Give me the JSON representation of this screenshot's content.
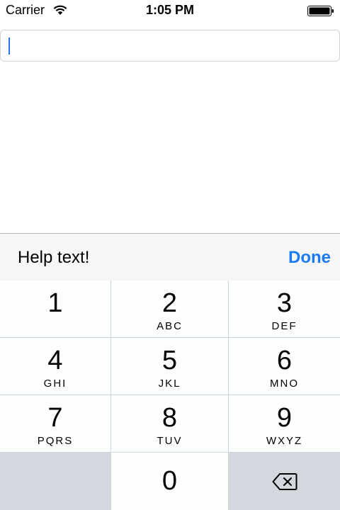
{
  "status_bar": {
    "carrier": "Carrier",
    "time": "1:05 PM",
    "wifi_icon": "wifi-icon",
    "battery_icon": "battery-icon"
  },
  "text_field": {
    "value": "",
    "cursor_color": "#2f6df6"
  },
  "toolbar": {
    "help_text": "Help text!",
    "done_label": "Done",
    "done_color": "#1a7cf5"
  },
  "keypad": {
    "keys": [
      {
        "num": "1",
        "letters": ""
      },
      {
        "num": "2",
        "letters": "ABC"
      },
      {
        "num": "3",
        "letters": "DEF"
      },
      {
        "num": "4",
        "letters": "GHI"
      },
      {
        "num": "5",
        "letters": "JKL"
      },
      {
        "num": "6",
        "letters": "MNO"
      },
      {
        "num": "7",
        "letters": "PQRS"
      },
      {
        "num": "8",
        "letters": "TUV"
      },
      {
        "num": "9",
        "letters": "WXYZ"
      },
      {
        "num": "0",
        "letters": ""
      }
    ],
    "delete_icon": "backspace-icon"
  }
}
